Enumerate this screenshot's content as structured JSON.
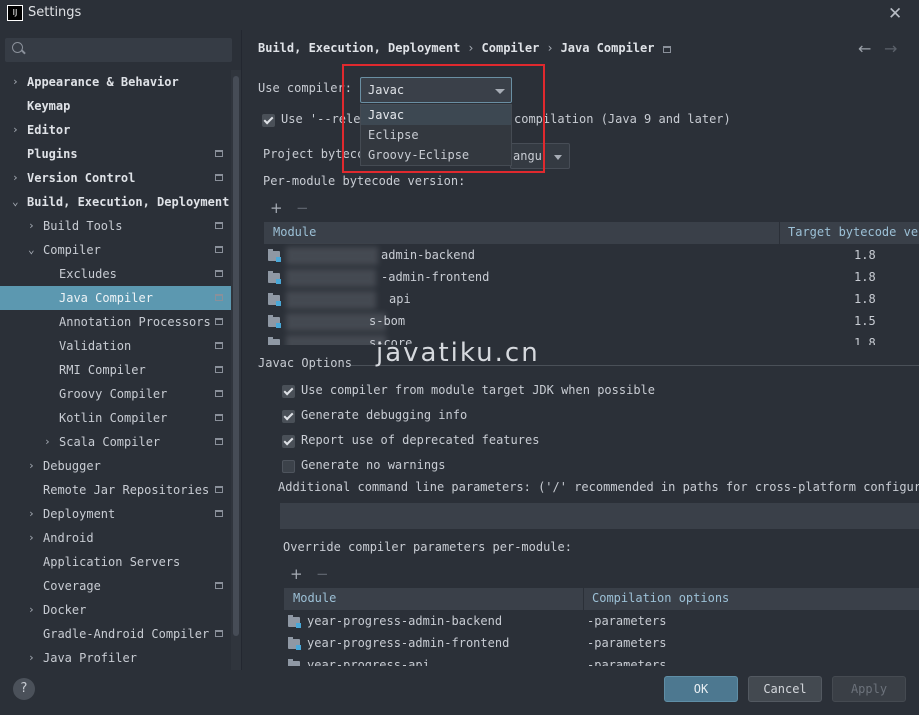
{
  "window": {
    "title": "Settings",
    "app_icon_text": "IJ"
  },
  "sidebar": {
    "items": [
      {
        "label": "Appearance & Behavior",
        "arrow": "›",
        "bold": true
      },
      {
        "label": "Keymap",
        "arrow": "",
        "bold": true
      },
      {
        "label": "Editor",
        "arrow": "›",
        "bold": true
      },
      {
        "label": "Plugins",
        "arrow": "",
        "bold": true,
        "page_icon": true
      },
      {
        "label": "Version Control",
        "arrow": "›",
        "bold": true,
        "page_icon": true
      },
      {
        "label": "Build, Execution, Deployment",
        "arrow": "⌄",
        "bold": true
      },
      {
        "label": "Build Tools",
        "arrow": "›",
        "page_icon": true
      },
      {
        "label": "Compiler",
        "arrow": "⌄",
        "page_icon": true
      },
      {
        "label": "Excludes",
        "arrow": "",
        "page_icon": true
      },
      {
        "label": "Java Compiler",
        "arrow": "",
        "page_icon": true,
        "selected": true
      },
      {
        "label": "Annotation Processors",
        "arrow": "",
        "page_icon": true
      },
      {
        "label": "Validation",
        "arrow": "",
        "page_icon": true
      },
      {
        "label": "RMI Compiler",
        "arrow": "",
        "page_icon": true
      },
      {
        "label": "Groovy Compiler",
        "arrow": "",
        "page_icon": true
      },
      {
        "label": "Kotlin Compiler",
        "arrow": "",
        "page_icon": true
      },
      {
        "label": "Scala Compiler",
        "arrow": "›",
        "page_icon": true
      },
      {
        "label": "Debugger",
        "arrow": "›"
      },
      {
        "label": "Remote Jar Repositories",
        "arrow": "",
        "page_icon": true
      },
      {
        "label": "Deployment",
        "arrow": "›",
        "page_icon": true
      },
      {
        "label": "Android",
        "arrow": "›"
      },
      {
        "label": "Application Servers",
        "arrow": ""
      },
      {
        "label": "Coverage",
        "arrow": "",
        "page_icon": true
      },
      {
        "label": "Docker",
        "arrow": "›"
      },
      {
        "label": "Gradle-Android Compiler",
        "arrow": "",
        "page_icon": true
      },
      {
        "label": "Java Profiler",
        "arrow": "›"
      }
    ]
  },
  "breadcrumb": {
    "items": [
      "Build, Execution, Deployment",
      "Compiler",
      "Java Compiler"
    ],
    "sep": "›"
  },
  "use_compiler": {
    "label": "Use compiler:",
    "value": "Javac",
    "options": [
      "Javac",
      "Eclipse",
      "Groovy-Eclipse"
    ],
    "selected_index": 0
  },
  "release_option": {
    "label_left": "Use '--rele",
    "label_right": "compilation (Java 9 and later)",
    "checked": true
  },
  "project_bytecode": {
    "label_left": "Project bytecc",
    "combo_value": "angu"
  },
  "per_module": {
    "label": "Per-module bytecode version:",
    "add": "+",
    "remove": "−",
    "columns": [
      "Module",
      "Target bytecode ver"
    ],
    "rows": [
      {
        "module": "admin-backend",
        "target": "1.8"
      },
      {
        "module": "-admin-frontend",
        "target": "1.8"
      },
      {
        "module": "api",
        "target": "1.8"
      },
      {
        "module": "s-bom",
        "target": "1.5"
      },
      {
        "module": "s-core",
        "target": "1.8"
      }
    ]
  },
  "javac_options": {
    "title": "Javac Options",
    "checks": [
      {
        "label": "Use compiler from module target JDK when possible",
        "checked": true
      },
      {
        "label": "Generate debugging info",
        "checked": true
      },
      {
        "label": "Report use of deprecated features",
        "checked": true
      },
      {
        "label": "Generate no warnings",
        "checked": false
      }
    ],
    "cmd_label": "Additional command line parameters:  ('/' recommended in paths for cross-platform configurat",
    "cmd_value": "",
    "override_label": "Override compiler parameters per-module:",
    "add": "+",
    "remove": "−",
    "columns": [
      "Module",
      "Compilation options"
    ],
    "rows": [
      {
        "module": "year-progress-admin-backend",
        "options": "-parameters"
      },
      {
        "module": "year-progress-admin-frontend",
        "options": "-parameters"
      },
      {
        "module": "year-progress-api",
        "options": "-parameters"
      }
    ]
  },
  "watermark": "javatiku.cn",
  "buttons": {
    "ok": "OK",
    "cancel": "Cancel",
    "apply": "Apply",
    "help": "?"
  },
  "icons": {
    "close": "close-icon",
    "back": "arrow-left-icon",
    "forward": "arrow-right-icon",
    "search": "search-icon"
  }
}
